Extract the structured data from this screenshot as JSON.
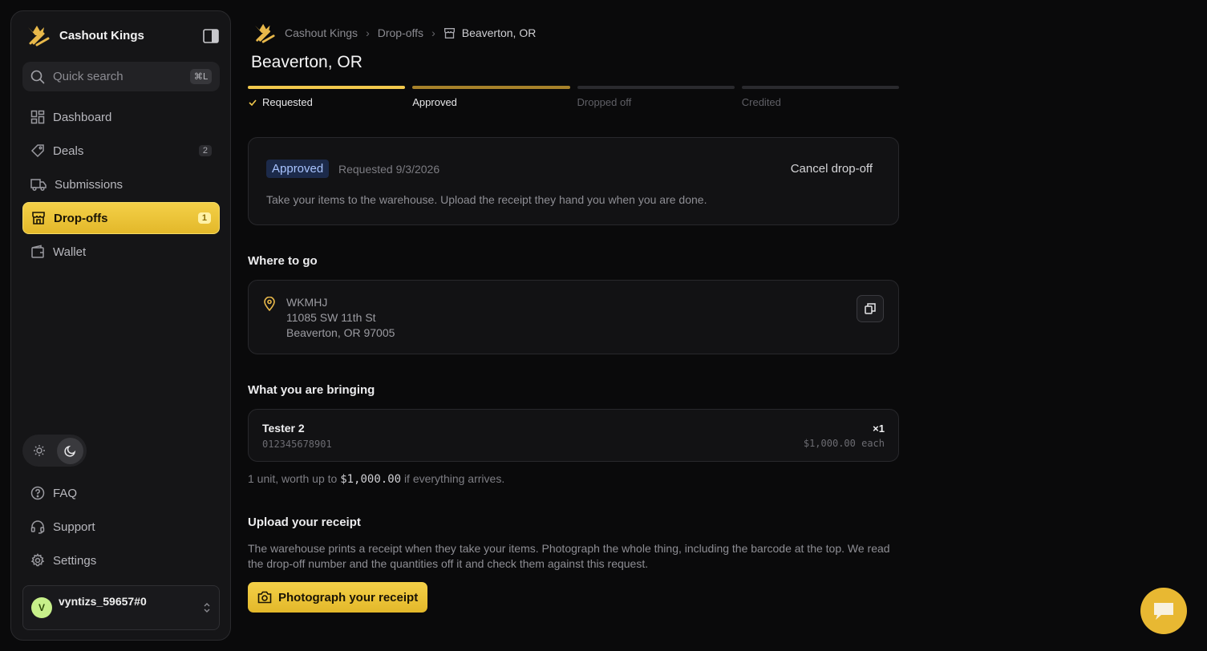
{
  "app": {
    "name": "Cashout Kings"
  },
  "search": {
    "placeholder": "Quick search",
    "shortcut": "⌘L"
  },
  "sidebar": {
    "items": [
      {
        "label": "Dashboard",
        "icon": "dashboard-icon"
      },
      {
        "label": "Deals",
        "icon": "tag-icon",
        "count": "2"
      },
      {
        "label": "Submissions",
        "icon": "truck-icon"
      },
      {
        "label": "Drop-offs",
        "icon": "store-icon",
        "count": "1",
        "active": true
      },
      {
        "label": "Wallet",
        "icon": "wallet-icon"
      }
    ],
    "bottom": [
      {
        "label": "FAQ",
        "icon": "help-circle-icon"
      },
      {
        "label": "Support",
        "icon": "headset-icon"
      },
      {
        "label": "Settings",
        "icon": "gear-icon"
      }
    ],
    "theme": {
      "selected": "dark"
    },
    "user": {
      "initial": "V",
      "name": "vyntizs_59657#0"
    }
  },
  "breadcrumb": {
    "root": "Cashout Kings",
    "section": "Drop-offs",
    "current": "Beaverton, OR"
  },
  "page": {
    "title": "Beaverton, OR"
  },
  "steps": [
    {
      "label": "Requested",
      "state": "done"
    },
    {
      "label": "Approved",
      "state": "current"
    },
    {
      "label": "Dropped off",
      "state": "pending"
    },
    {
      "label": "Credited",
      "state": "pending"
    }
  ],
  "status": {
    "badge": "Approved",
    "requested": "Requested 9/3/2026",
    "cancel_label": "Cancel drop-off",
    "description": "Take your items to the warehouse. Upload the receipt they hand you when you are done."
  },
  "where": {
    "title": "Where to go",
    "lines": [
      "WKMHJ",
      "11085 SW 11th St",
      "Beaverton, OR 97005"
    ]
  },
  "bringing": {
    "title": "What you are bringing",
    "item": {
      "name": "Tester 2",
      "code": "012345678901",
      "qty": "×1",
      "each": "$1,000.00 each"
    },
    "summary_pre": "1 unit, worth up to",
    "summary_amount": "$1,000.00",
    "summary_post": "if everything arrives."
  },
  "upload": {
    "title": "Upload your receipt",
    "description": "The warehouse prints a receipt when they take your items. Photograph the whole thing, including the barcode at the top. We read the drop-off number and the quantities off it and check them against this request.",
    "button": "Photograph your receipt"
  },
  "colors": {
    "accent": "#f2c94c",
    "badge_bg": "#1c2a4a",
    "badge_text": "#a9c4ff"
  }
}
